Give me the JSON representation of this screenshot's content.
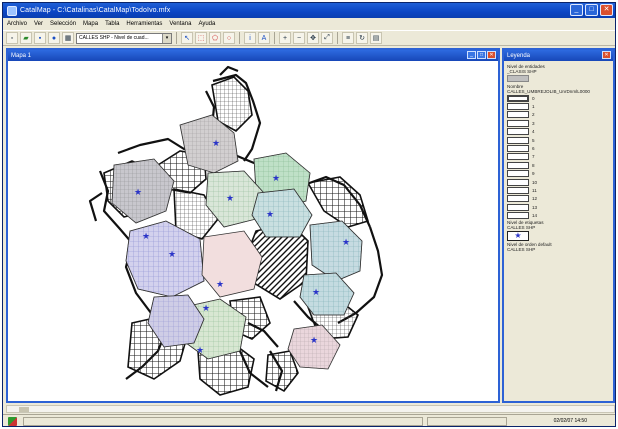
{
  "window": {
    "title": "CatalMap - C:\\Catalinas\\CatalMap\\TodoIvo.mfx"
  },
  "menu": [
    "Archivo",
    "Ver",
    "Selección",
    "Mapa",
    "Tabla",
    "Herramientas",
    "Ventana",
    "Ayuda"
  ],
  "toolbar": {
    "layer_select": "CALLES SHP - Nivel de cuad..."
  },
  "map_window": {
    "title": "Mapa 1"
  },
  "legend": {
    "title": "Leyenda",
    "layer1_label": "Nivel de entidades",
    "layer1_name": "_CLASIS SHP",
    "layer2_label": "Nombre",
    "field_label": "CALLES_UMBREJOLIB_UnrDnmlL0000",
    "items": [
      "0",
      "1",
      "2",
      "3",
      "4",
      "5",
      "6",
      "7",
      "8",
      "9",
      "10",
      "11",
      "12",
      "13",
      "14"
    ],
    "points_label": "Nivel de etiquetas",
    "points_name": "CALLES SHP",
    "default_label": "Nivel de orden default",
    "default_name": "CALLES SHP"
  },
  "status": {
    "time": "02/02/07 14:50"
  },
  "colors": {
    "title_bar": "#0b45c4",
    "close": "#d9502e",
    "star": "#2b35c8"
  }
}
